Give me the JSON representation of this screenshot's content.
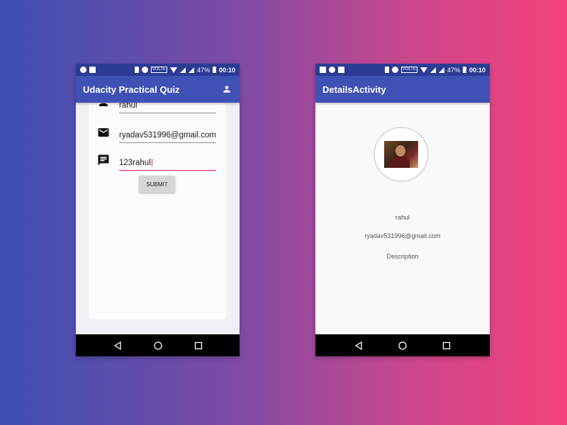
{
  "status_bar": {
    "battery": "47%",
    "time": "00:10",
    "volte": "VOLTE"
  },
  "left_screen": {
    "title": "Udacity Practical Quiz",
    "form": {
      "name_value": "rahul",
      "email_value": "ryadav531996@gmail.com",
      "message_value": "123rahul",
      "submit_label": "SUBMIT"
    }
  },
  "right_screen": {
    "title": "DetailsActivity",
    "name": "rahul",
    "email": "ryadav531996@gmail.com",
    "description": "Description"
  },
  "colors": {
    "primary": "#3f51b5",
    "primary_dark": "#2c3b93",
    "accent": "#ff4081"
  },
  "icons": {
    "appbar_action": "person-icon",
    "fab": "mail-icon",
    "nav": [
      "back-icon",
      "home-icon",
      "recents-icon"
    ]
  }
}
